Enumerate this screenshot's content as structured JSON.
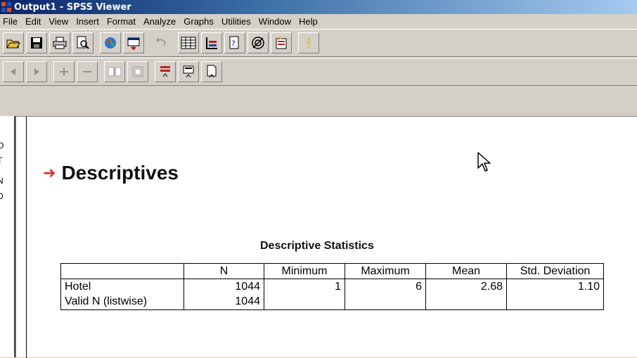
{
  "window": {
    "title": "Output1 - SPSS Viewer"
  },
  "menu": [
    "File",
    "Edit",
    "View",
    "Insert",
    "Format",
    "Analyze",
    "Graphs",
    "Utilities",
    "Window",
    "Help"
  ],
  "toolbar1_icons": [
    "open-icon",
    "save-icon",
    "print-icon",
    "print-preview-icon",
    "export-icon",
    "recall-dialog-icon",
    "undo-icon",
    "goto-data-icon",
    "goto-case-icon",
    "variables-icon",
    "use-sets-icon",
    "designate-window-icon",
    "run-icon"
  ],
  "toolbar2_icons": [
    "promote-icon",
    "demote-icon",
    "expand-icon",
    "collapse-icon",
    "show-icon",
    "hide-icon",
    "insert-heading-icon",
    "insert-title-icon",
    "insert-text-icon"
  ],
  "outline": {
    "labels": [
      "O",
      "T",
      "N",
      "D"
    ]
  },
  "output": {
    "heading": "Descriptives",
    "table_title": "Descriptive Statistics",
    "columns": [
      "",
      "N",
      "Minimum",
      "Maximum",
      "Mean",
      "Std. Deviation"
    ],
    "rows": [
      [
        "Hotel",
        "1044",
        "1",
        "6",
        "2.68",
        "1.10"
      ],
      [
        "Valid N (listwise)",
        "1044",
        "",
        "",
        "",
        ""
      ]
    ]
  },
  "colors": {
    "titlebar": "#0a246a",
    "chrome": "#d4d0c8",
    "arrow": "#e03020",
    "backdrop": "#fdd54a"
  }
}
